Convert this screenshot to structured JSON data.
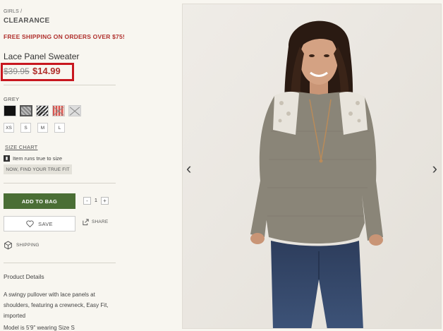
{
  "breadcrumb": {
    "parent": "GIRLS",
    "separator": "/",
    "current": "CLEARANCE"
  },
  "promo": {
    "text": "FREE SHIPPING ON ORDERS OVER $75!"
  },
  "product": {
    "title": "Lace Panel Sweater",
    "price_original": "$39.95",
    "price_sale": "$14.99"
  },
  "color": {
    "label": "GREY",
    "swatches": [
      {
        "name": "black",
        "unavailable": false
      },
      {
        "name": "grey",
        "selected": true,
        "unavailable": false
      },
      {
        "name": "black-white-pattern",
        "unavailable": true
      },
      {
        "name": "red-stripe",
        "unavailable": true
      },
      {
        "name": "light-grey",
        "unavailable": true
      }
    ]
  },
  "sizes": [
    "XS",
    "S",
    "M",
    "L"
  ],
  "fit": {
    "size_chart": "SIZE CHART",
    "runs_true": "Item runs true to size",
    "find_fit_button": "NOW, FIND YOUR TRUE FIT"
  },
  "cart": {
    "add_label": "ADD TO BAG",
    "qty_minus": "-",
    "qty_value": "1",
    "qty_plus": "+"
  },
  "actions": {
    "save_label": "SAVE",
    "share_label": "SHARE",
    "shipping_label": "SHIPPING"
  },
  "details": {
    "heading": "Product Details",
    "description": "A swingy pullover with lace panels at shoulders, featuring a crewneck, Easy Fit, imported",
    "model": "Model is 5'9\" wearing Size S"
  },
  "gallery": {
    "prev_arrow": "‹",
    "next_arrow": "›"
  },
  "colors": {
    "promo_red": "#b0302d",
    "highlight_box": "#c8171f",
    "bag_green": "#4a6e35",
    "page_bg": "#f8f6f0"
  }
}
